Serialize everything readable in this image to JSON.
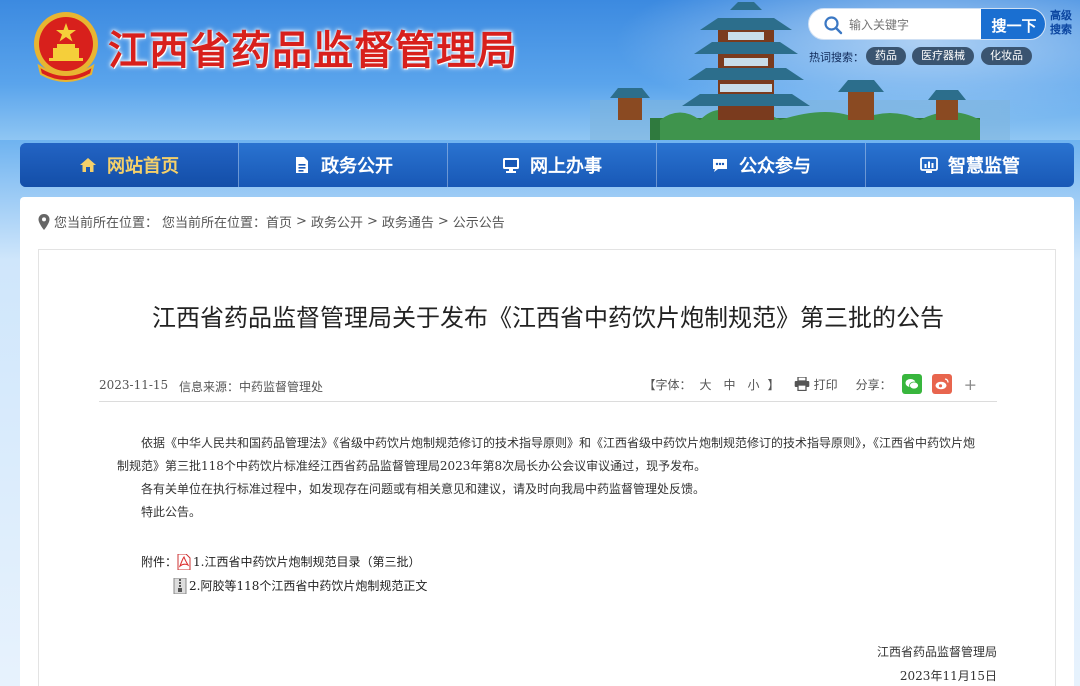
{
  "header": {
    "site_title": "江西省药品监督管理局",
    "search": {
      "placeholder": "输入关键字",
      "button_label": "搜一下",
      "advanced_label": "高级搜索"
    },
    "hot_label": "热词搜索：",
    "hot_tags": [
      "药品",
      "医疗器械",
      "化妆品"
    ]
  },
  "nav": {
    "items": [
      {
        "label": "网站首页",
        "icon": "home-icon"
      },
      {
        "label": "政务公开",
        "icon": "document-icon"
      },
      {
        "label": "网上办事",
        "icon": "monitor-icon"
      },
      {
        "label": "公众参与",
        "icon": "chat-icon"
      },
      {
        "label": "智慧监管",
        "icon": "chart-icon"
      }
    ]
  },
  "breadcrumb": {
    "prefix": "您当前所在位置：",
    "items": [
      "您当前所在位置：首页",
      "政务公开",
      "政务通告",
      "公示公告"
    ],
    "separator": ">"
  },
  "article": {
    "title": "江西省药品监督管理局关于发布《江西省中药饮片炮制规范》第三批的公告",
    "date": "2023-11-15",
    "source": "信息来源：中药监督管理处",
    "font_label_open": "【字体：",
    "font_sizes": [
      "大",
      "中",
      "小"
    ],
    "font_label_close": "】",
    "print_label": "打印",
    "share_label": "分享：",
    "paragraphs": [
      "依据《中华人民共和国药品管理法》《省级中药饮片炮制规范修订的技术指导原则》和《江西省级中药饮片炮制规范修订的技术指导原则》，《江西省中药饮片炮制规范》第三批118个中药饮片标准经江西省药品监督管理局2023年第8次局长办公会议审议通过，现予发布。",
      "各有关单位在执行标准过程中，如发现存在问题或有相关意见和建议，请及时向我局中药监督管理处反馈。",
      "特此公告。"
    ],
    "attachments_label": "附件：",
    "attachments": [
      {
        "label": "1.江西省中药饮片炮制规范目录（第三批）",
        "icon": "pdf-icon"
      },
      {
        "label": "2.阿胶等118个江西省中药饮片炮制规范正文",
        "icon": "zip-icon"
      }
    ],
    "signature": "江西省药品监督管理局",
    "sign_date": "2023年11月15日"
  },
  "colors": {
    "brand_red": "#d8201c",
    "nav_blue": "#1858b6",
    "nav_active_text": "#f4d06a"
  }
}
